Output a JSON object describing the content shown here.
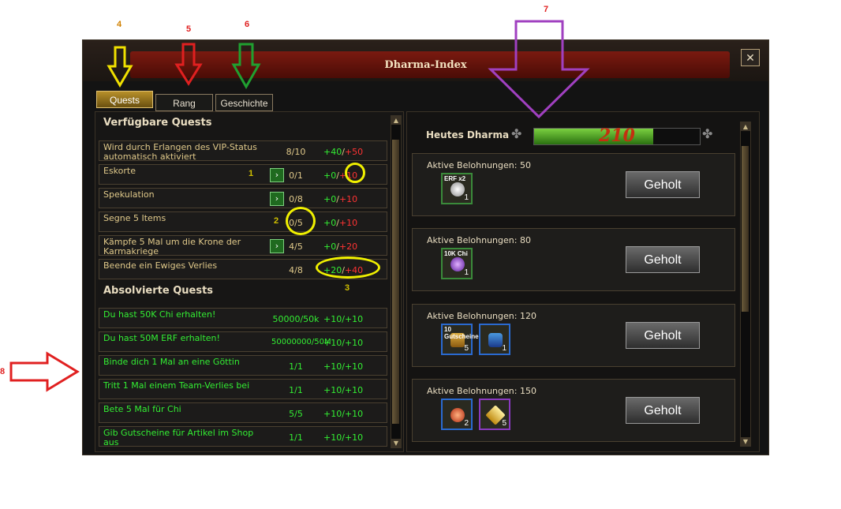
{
  "annotations": {
    "a4": "4",
    "a5": "5",
    "a6": "6",
    "a7": "7",
    "a8": "8",
    "c1": "1",
    "c2": "2",
    "c3": "3",
    "colors": {
      "yellow": "#f0e000",
      "red": "#e02020",
      "green": "#20a030",
      "purple": "#a040c0"
    }
  },
  "window": {
    "title": "Dharma-Index",
    "close_glyph": "✕"
  },
  "tabs": [
    "Quests",
    "Rang",
    "Geschichte"
  ],
  "left": {
    "available_title": "Verfügbare Quests",
    "completed_title": "Absolvierte Quests",
    "available": [
      {
        "name": "Wird durch Erlangen des VIP-Status automatisch aktiviert",
        "progress": "8/10",
        "reward_a": "+40",
        "reward_b": "+50"
      },
      {
        "name": "Eskorte",
        "progress": "0/1",
        "reward_a": "+0",
        "reward_b": "+10"
      },
      {
        "name": "Spekulation",
        "progress": "0/8",
        "reward_a": "+0",
        "reward_b": "+10"
      },
      {
        "name": "Segne 5 Items",
        "progress": "0/5",
        "reward_a": "+0",
        "reward_b": "+10"
      },
      {
        "name": "Kämpfe 5 Mal um die Krone der Karmakriege",
        "progress": "4/5",
        "reward_a": "+0",
        "reward_b": "+20"
      },
      {
        "name": "Beende ein Ewiges Verlies",
        "progress": "4/8",
        "reward_a": "+20",
        "reward_b": "+40"
      }
    ],
    "completed": [
      {
        "name": "Du hast 50K Chi erhalten!",
        "progress": "50000/50k",
        "reward_a": "+10",
        "reward_b": "+10"
      },
      {
        "name": "Du hast 50M ERF erhalten!",
        "progress": "50000000/50M",
        "reward_a": "+10",
        "reward_b": "+10"
      },
      {
        "name": "Binde dich 1 Mal an eine Göttin",
        "progress": "1/1",
        "reward_a": "+10",
        "reward_b": "+10"
      },
      {
        "name": "Tritt 1 Mal einem Team-Verlies bei",
        "progress": "1/1",
        "reward_a": "+10",
        "reward_b": "+10"
      },
      {
        "name": "Bete 5 Mal für Chi",
        "progress": "5/5",
        "reward_a": "+10",
        "reward_b": "+10"
      },
      {
        "name": "Gib Gutscheine für Artikel im Shop aus",
        "progress": "1/1",
        "reward_a": "+10",
        "reward_b": "+10"
      }
    ],
    "arrow_glyph": "›"
  },
  "right": {
    "dharma_label": "Heutes Dharma",
    "dharma_value": "210",
    "dharma_fill": 0.72,
    "rewards": [
      {
        "label": "Aktive Belohnungen:",
        "value": "50",
        "items": [
          {
            "text": "ERF x2",
            "count": "1",
            "color": "green",
            "icon": "pearl-icon"
          }
        ],
        "button": "Geholt"
      },
      {
        "label": "Aktive Belohnungen:",
        "value": "80",
        "items": [
          {
            "text": "10K Chi",
            "count": "1",
            "color": "green",
            "icon": "purple-orb-icon"
          }
        ],
        "button": "Geholt"
      },
      {
        "label": "Aktive Belohnungen:",
        "value": "120",
        "items": [
          {
            "text": "10 Gutscheine",
            "count": "5",
            "color": "blue",
            "icon": "voucher-icon"
          },
          {
            "text": "",
            "count": "1",
            "color": "blue",
            "icon": "potion-icon"
          }
        ],
        "button": "Geholt"
      },
      {
        "label": "Aktive Belohnungen:",
        "value": "150",
        "items": [
          {
            "text": "",
            "count": "2",
            "color": "blue",
            "icon": "red-orbs-icon"
          },
          {
            "text": "",
            "count": "5",
            "color": "purple",
            "icon": "gold-crystal-icon"
          }
        ],
        "button": "Geholt"
      }
    ]
  }
}
